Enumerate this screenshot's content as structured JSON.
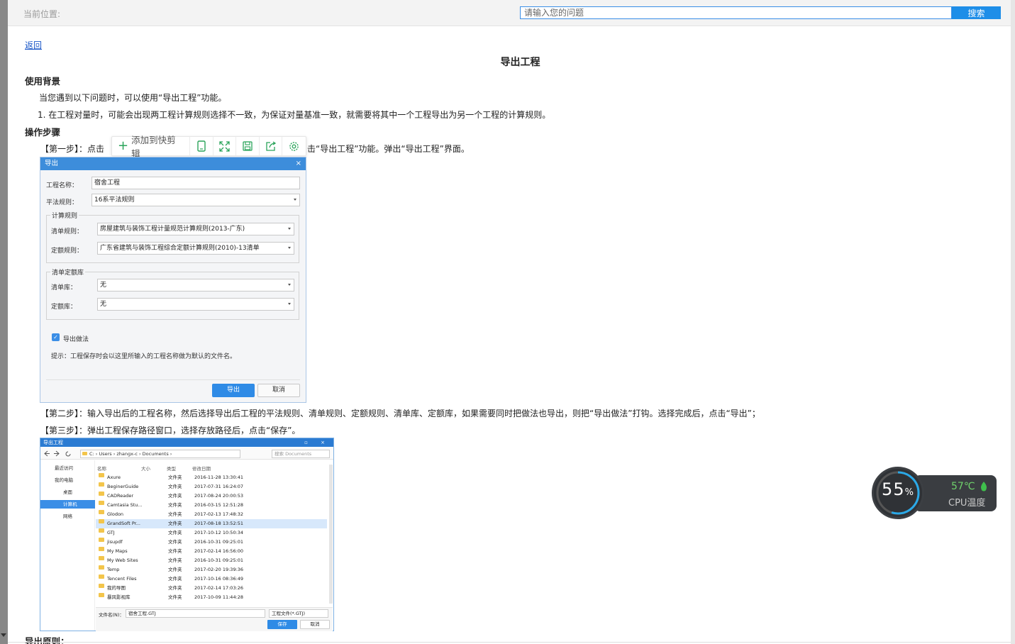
{
  "topbar": {
    "location_label": "当前位置:",
    "search_placeholder": "请输入您的问题",
    "search_button": "搜索"
  },
  "back_link": "返回",
  "page_title": "导出工程",
  "section_background": {
    "heading": "使用背景",
    "intro": "当您遇到以下问题时，可以使用“导出工程”功能。",
    "item_1": "1. 在工程对量时，可能会出现两工程计算规则选择不一致，为保证对量基准一致，就需要将其中一个工程导出为另一个工程的计算规则。"
  },
  "section_steps": {
    "heading": "操作步骤",
    "step1_prefix": "【第一步】：点击",
    "step1_suffix": "击“导出工程”功能。弹出“导出工程”界面。",
    "step2": "【第二步】：输入导出后的工程名称，然后选择导出后工程的平法规则、清单规则、定额规则、清单库、定额库，如果需要同时把做法也导出，则把“导出做法”打钩。选择完成后，点击“导出”；",
    "step3": "【第三步】：弹出工程保存路径窗口，选择存放路径后，点击“保存”。"
  },
  "section_principle": {
    "heading": "导出原则："
  },
  "float_toolbar": {
    "add_label": "添加到快剪辑",
    "icons": [
      "phone-icon",
      "expand-icon",
      "save-icon",
      "share-icon",
      "settings-icon"
    ]
  },
  "export_dialog": {
    "title": "导出",
    "close": "×",
    "project_name_label": "工程名称：",
    "project_name_value": "宿舍工程",
    "pingfa_label": "平法规则：",
    "pingfa_value": "16系平法规则",
    "calc_group": "计算规则",
    "qingdan_rule_label": "清单规则：",
    "qingdan_rule_value": "房屋建筑与装饰工程计量规范计算规则(2013-广东)",
    "dinge_rule_label": "定额规则：",
    "dinge_rule_value": "广东省建筑与装饰工程综合定额计算规则(2010)-13清单",
    "lib_group": "清单定额库",
    "qingdan_lib_label": "清单库：",
    "qingdan_lib_value": "无",
    "dinge_lib_label": "定额库：",
    "dinge_lib_value": "无",
    "export_method_label": "导出做法",
    "tip": "提示：工程保存时会以这里所输入的工程名称做为默认的文件名。",
    "export_button": "导出",
    "cancel_button": "取消"
  },
  "save_dialog": {
    "title": "导出工程",
    "title_buttons": "▫ ×",
    "path": "C: › Users › zhangx-c › Documents ›",
    "search_placeholder": "搜索 Documents",
    "nav": [
      "最近访问",
      "我的电脑",
      "桌面",
      "计算机",
      "网络"
    ],
    "columns": [
      "名称",
      "大小",
      "类型",
      "修改日期"
    ],
    "files": [
      {
        "name": "Axure",
        "type": "文件夹",
        "date": "2016-11-28 13:30:41"
      },
      {
        "name": "BeginerGuide",
        "type": "文件夹",
        "date": "2017-07-31 16:24:07"
      },
      {
        "name": "CADReader",
        "type": "文件夹",
        "date": "2017-08-24 20:00:53"
      },
      {
        "name": "Camtasia Stu...",
        "type": "文件夹",
        "date": "2016-03-15 12:51:28"
      },
      {
        "name": "Glodon",
        "type": "文件夹",
        "date": "2017-02-13 17:48:32"
      },
      {
        "name": "GrandSoft Pr...",
        "type": "文件夹",
        "date": "2017-08-18 13:52:51"
      },
      {
        "name": "GTJ",
        "type": "文件夹",
        "date": "2017-10-12 10:50:34"
      },
      {
        "name": "jisupdf",
        "type": "文件夹",
        "date": "2016-10-31 09:25:01"
      },
      {
        "name": "My Maps",
        "type": "文件夹",
        "date": "2017-02-14 16:56:00"
      },
      {
        "name": "My Web Sites",
        "type": "文件夹",
        "date": "2016-10-31 09:25:01"
      },
      {
        "name": "Temp",
        "type": "文件夹",
        "date": "2017-02-20 19:39:36"
      },
      {
        "name": "Tencent Files",
        "type": "文件夹",
        "date": "2017-10-16 08:36:49"
      },
      {
        "name": "我的导图",
        "type": "文件夹",
        "date": "2017-02-14 17:03:26"
      },
      {
        "name": "暴风影视库",
        "type": "文件夹",
        "date": "2017-10-09 11:44:28"
      }
    ],
    "filename_label": "文件名(N)：",
    "filename_value": "宿舍工程.GTJ",
    "filetype_value": "工程文件(*.GTJ)",
    "save_button": "保存",
    "cancel_button": "取消"
  },
  "cpu_widget": {
    "percent": "55",
    "percent_sign": "%",
    "temperature": "57℃",
    "label": "CPU温度",
    "accent_color": "#6fd26b"
  }
}
